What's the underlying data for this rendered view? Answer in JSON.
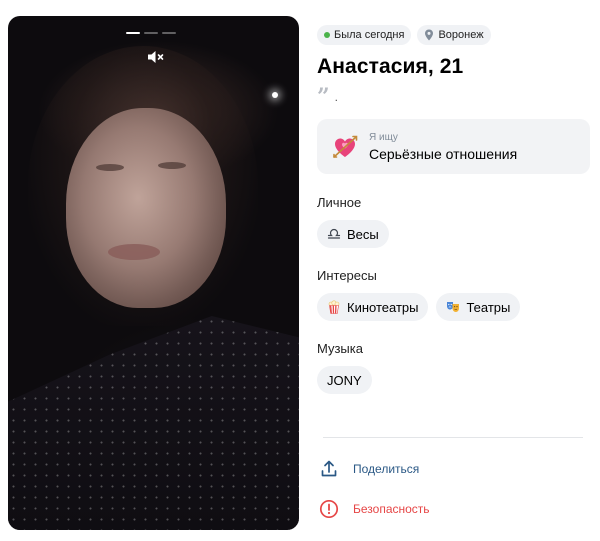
{
  "media": {
    "progress_segments": 3,
    "active_segment": 1,
    "mute_icon": "speaker-muted-icon"
  },
  "profile": {
    "status_label": "Была сегодня",
    "status_color": "#4bb34b",
    "location_label": "Воронеж",
    "name_age": "Анастасия, 21",
    "quote_text": "."
  },
  "looking_for": {
    "label": "Я ищу",
    "value": "Серьёзные отношения",
    "icon": "heart-with-arrow-icon"
  },
  "personal": {
    "title": "Личное",
    "chips": [
      {
        "label": "Весы",
        "icon": "libra-icon"
      }
    ]
  },
  "interests": {
    "title": "Интересы",
    "chips": [
      {
        "label": "Кинотеатры",
        "icon": "popcorn-icon"
      },
      {
        "label": "Театры",
        "icon": "theater-masks-icon"
      }
    ]
  },
  "music": {
    "title": "Музыка",
    "chips": [
      {
        "label": "JONY"
      }
    ]
  },
  "actions": {
    "share_label": "Поделиться",
    "safety_label": "Безопасность",
    "share_color": "#2a5885",
    "safety_color": "#e64646"
  }
}
